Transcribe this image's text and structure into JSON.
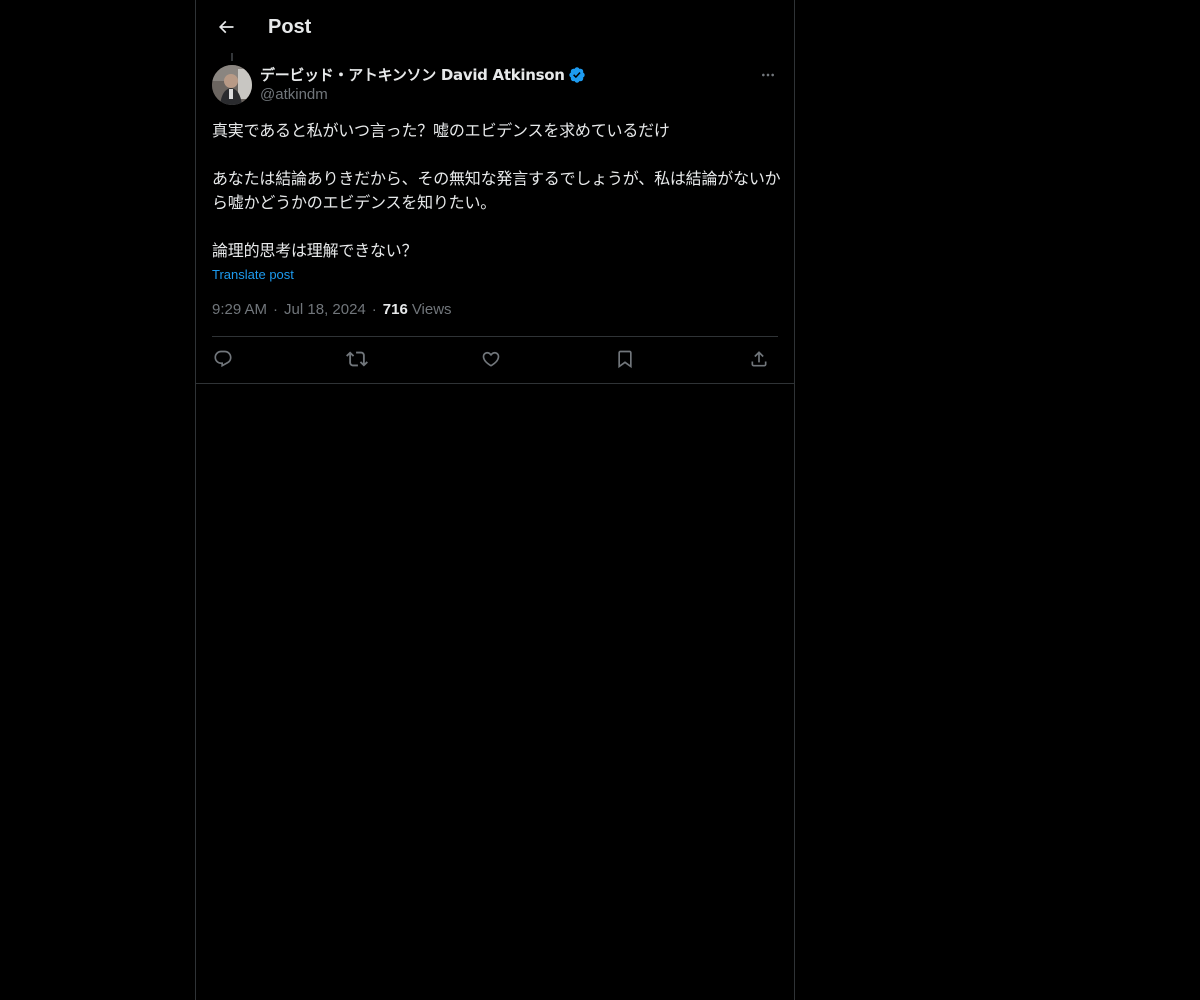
{
  "header": {
    "title": "Post",
    "back_icon": "arrow-left-icon"
  },
  "author": {
    "display_name": "デービッド・アトキンソン David Atkinson",
    "handle": "@atkindm",
    "verified": true,
    "verified_color": "#1d9bf0"
  },
  "post": {
    "paragraphs": [
      "真実であると私がいつ言った？嘘のエビデンスを求めているだけ",
      "あなたは結論ありきだから、その無知な発言するでしょうが、私は結論がないから嘘かどうかのエビデンスを知りたい。",
      "論理的思考は理解できない？"
    ],
    "translate_label": "Translate post",
    "time": "9:29 AM",
    "date": "Jul 18, 2024",
    "views_count": "716",
    "views_label": "Views"
  },
  "actions": {
    "reply_icon": "reply-icon",
    "repost_icon": "repost-icon",
    "like_icon": "like-icon",
    "bookmark_icon": "bookmark-icon",
    "share_icon": "share-icon"
  },
  "colors": {
    "background": "#000000",
    "text": "#e7e9ea",
    "secondary": "#71767b",
    "accent": "#1d9bf0",
    "border": "#2f3336"
  }
}
